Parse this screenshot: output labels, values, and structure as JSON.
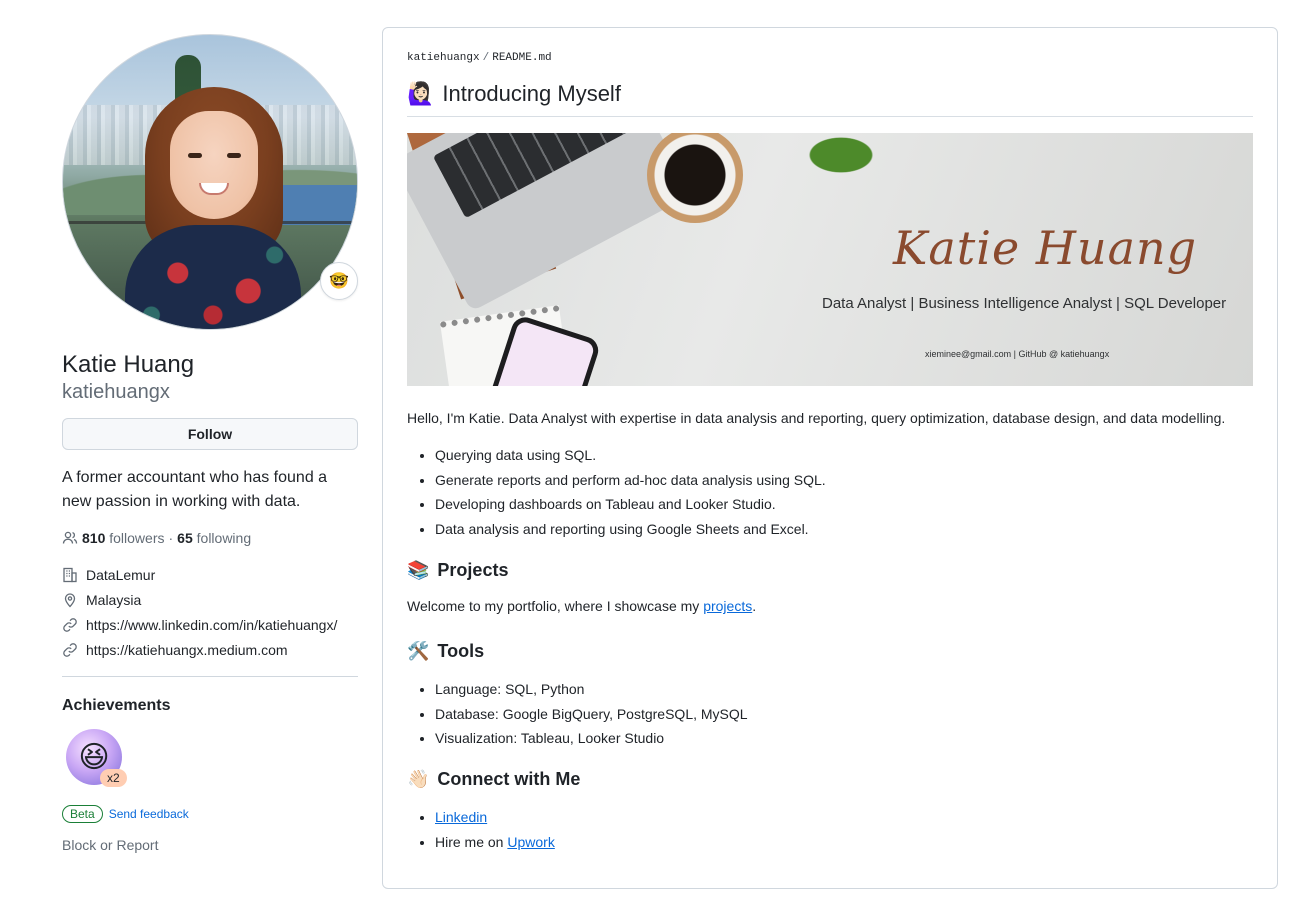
{
  "profile": {
    "name": "Katie Huang",
    "username": "katiehuangx",
    "status_emoji": "🤓",
    "follow_label": "Follow",
    "bio": "A former accountant who has found a new passion in working with data.",
    "followers_count": "810",
    "followers_label": "followers",
    "separator": "·",
    "following_count": "65",
    "following_label": "following",
    "company": "DataLemur",
    "location": "Malaysia",
    "links": [
      "https://www.linkedin.com/in/katiehuangx/",
      "https://katiehuangx.medium.com"
    ],
    "achievements_title": "Achievements",
    "achievement_multiplier": "x2",
    "achievement_emoji": "😆",
    "beta_label": "Beta",
    "send_feedback_label": "Send feedback",
    "block_report_label": "Block or Report"
  },
  "readme": {
    "path_user": "katiehuangx",
    "path_sep": "/",
    "path_file": "README.md",
    "title_emoji": "🙋🏻‍♀️",
    "title": "Introducing Myself",
    "banner": {
      "signature": "Katie Huang",
      "roles": "Data Analyst | Business Intelligence Analyst | SQL Developer",
      "contact": "xieminee@gmail.com | GitHub @ katiehuangx"
    },
    "intro": "Hello, I'm Katie. Data Analyst with expertise in data analysis and reporting, query optimization, database design, and data modelling.",
    "skills": [
      "Querying data using SQL.",
      "Generate reports and perform ad-hoc data analysis using SQL.",
      "Developing dashboards on Tableau and Looker Studio.",
      "Data analysis and reporting using Google Sheets and Excel."
    ],
    "projects_emoji": "📚",
    "projects_title": "Projects",
    "projects_text_prefix": "Welcome to my portfolio, where I showcase my ",
    "projects_link": "projects",
    "projects_text_suffix": ".",
    "tools_emoji": "🛠️",
    "tools_title": "Tools",
    "tools": [
      "Language: SQL, Python",
      "Database: Google BigQuery, PostgreSQL, MySQL",
      "Visualization: Tableau, Looker Studio"
    ],
    "connect_emoji": "👋🏻",
    "connect_title": "Connect with Me",
    "linkedin_link": "Linkedin",
    "hire_prefix": "Hire me on ",
    "upwork_link": "Upwork"
  }
}
